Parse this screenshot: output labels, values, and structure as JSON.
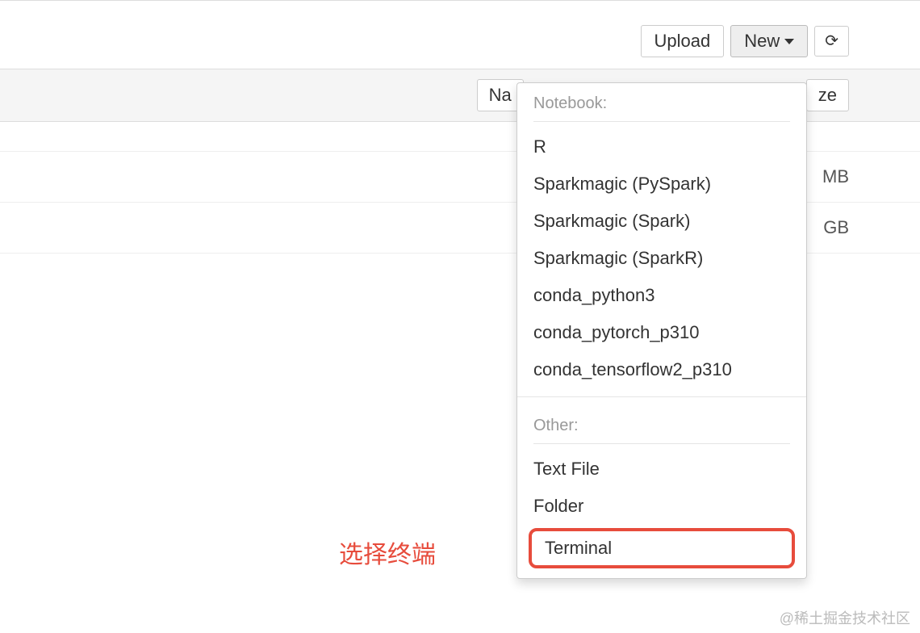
{
  "toolbar": {
    "upload_label": "Upload",
    "new_label": "New",
    "refresh_glyph": "⟳"
  },
  "headers": {
    "name_label": "Na",
    "size_label": "ze"
  },
  "file_rows": [
    {
      "size": ""
    },
    {
      "size": "MB"
    },
    {
      "size": "GB"
    }
  ],
  "dropdown": {
    "notebook_header": "Notebook:",
    "notebook_items": [
      "R",
      "Sparkmagic (PySpark)",
      "Sparkmagic (Spark)",
      "Sparkmagic (SparkR)",
      "conda_python3",
      "conda_pytorch_p310",
      "conda_tensorflow2_p310"
    ],
    "other_header": "Other:",
    "other_items": [
      {
        "label": "Text File",
        "highlighted": false
      },
      {
        "label": "Folder",
        "highlighted": false
      },
      {
        "label": "Terminal",
        "highlighted": true
      }
    ]
  },
  "annotation": "选择终端",
  "watermark": "@稀土掘金技术社区"
}
